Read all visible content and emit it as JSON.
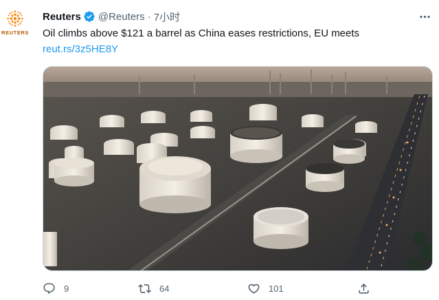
{
  "tweet": {
    "avatar_text": "REUTERS",
    "display_name": "Reuters",
    "handle": "@Reuters",
    "separator": "·",
    "time": "7小时",
    "text": "Oil climbs above $121 a barrel as China eases restrictions, EU meets",
    "link": "reut.rs/3z5HE8Y",
    "media_alt": "",
    "stats": {
      "replies": "9",
      "retweets": "64",
      "likes": "101"
    }
  },
  "colors": {
    "text": "#0f1419",
    "secondary": "#536471",
    "link": "#1d9bf0",
    "verified": "#1d9bf0",
    "reuters_orange": "#ff8000"
  },
  "icons": [
    "reuters-logo-icon",
    "verified-badge-icon",
    "more-icon",
    "reply-icon",
    "retweet-icon",
    "like-icon",
    "share-icon"
  ]
}
